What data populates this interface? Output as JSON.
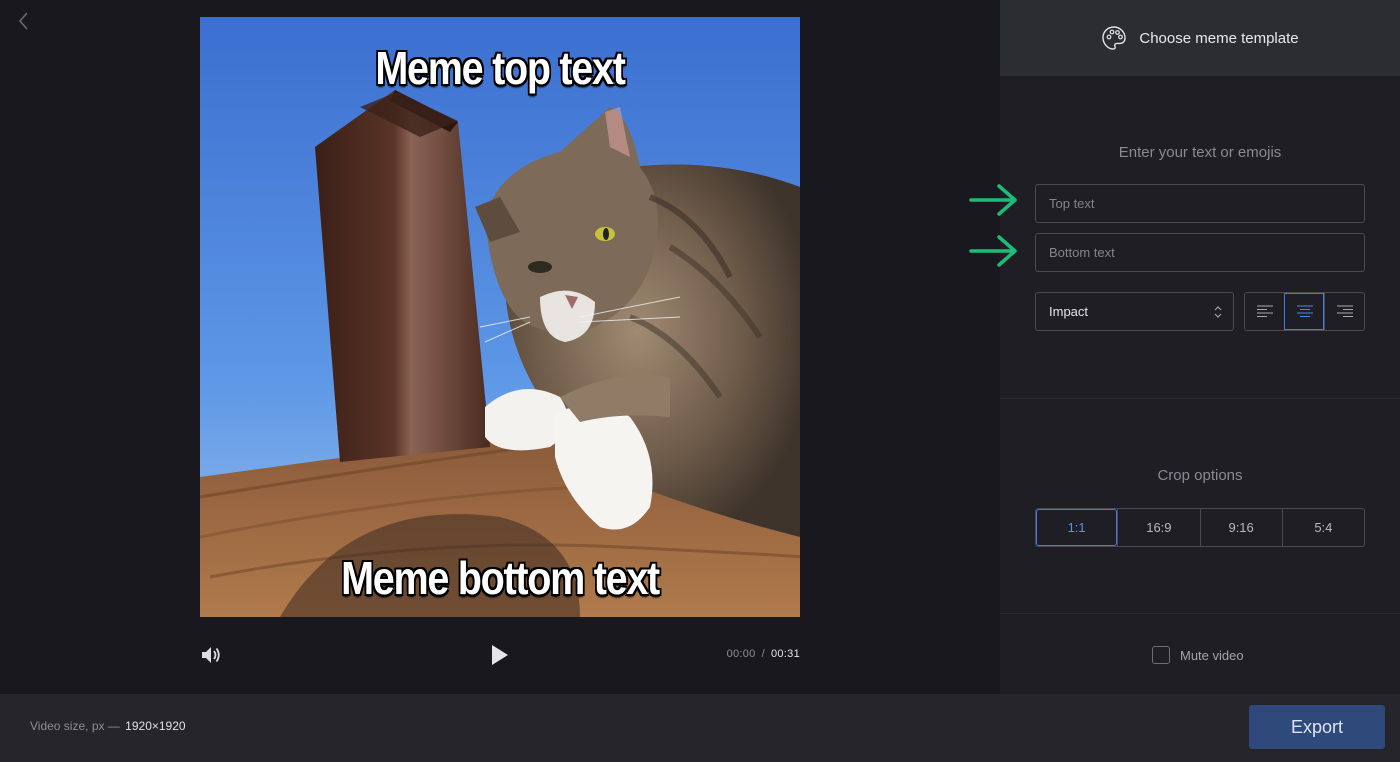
{
  "editor": {
    "back_icon": "chevron-left-icon",
    "meme": {
      "top_text": "Meme top text",
      "bottom_text": "Meme bottom text"
    },
    "player": {
      "volume_icon": "speaker-icon",
      "play_icon": "play-icon",
      "current_time": "00:00",
      "separator": "/",
      "total_time": "00:31"
    }
  },
  "panel": {
    "template_label": "Choose meme template",
    "template_icon": "palette-icon",
    "text_section": {
      "title": "Enter your text or emojis",
      "top_placeholder": "Top text",
      "top_value": "",
      "bottom_placeholder": "Bottom text",
      "bottom_value": "",
      "font": "Impact",
      "alignments": [
        "align-left-icon",
        "align-center-icon",
        "align-right-icon"
      ],
      "active_alignment": "center"
    },
    "crop_section": {
      "title": "Crop options",
      "options": [
        "1:1",
        "16:9",
        "9:16",
        "5:4"
      ],
      "active": "1:1"
    },
    "mute": {
      "label": "Mute video",
      "checked": false
    }
  },
  "footer": {
    "size_label": "Video size, px —",
    "size_value": "1920×1920",
    "export_label": "Export"
  },
  "colors": {
    "accent": "#3d7bf0",
    "export_bg": "#2f4a7a",
    "arrow_green": "#1dbd79",
    "panel_bg": "#1e1e24",
    "stage_bg": "#18181e"
  }
}
